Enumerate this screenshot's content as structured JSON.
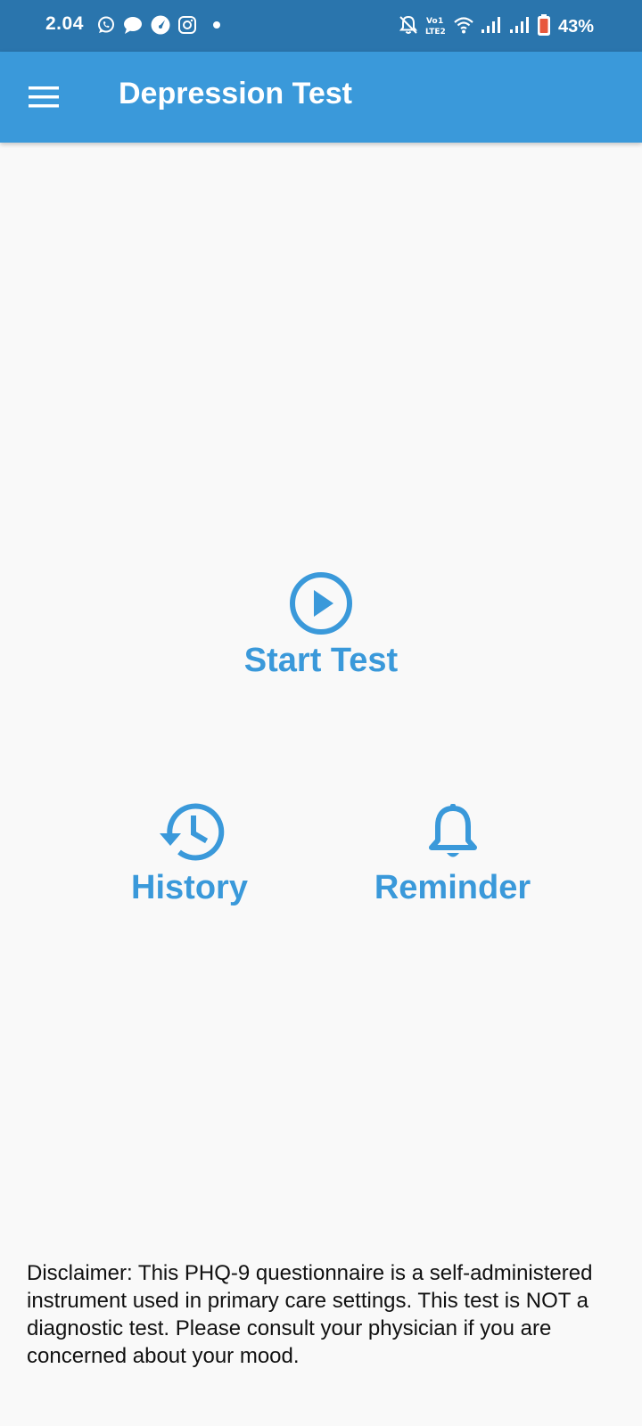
{
  "status_bar": {
    "time": "2.04",
    "battery_percent": "43%",
    "left_icons": [
      "whatsapp-icon",
      "chat-bubble-icon",
      "speedometer-icon",
      "instagram-icon",
      "dot-icon"
    ],
    "right_icons": [
      "mute-bell-icon",
      "volte-lte2-icon",
      "wifi-icon",
      "signal-icon",
      "signal-icon",
      "battery-icon"
    ]
  },
  "app_bar": {
    "title": "Depression Test",
    "menu_icon": "hamburger-menu-icon"
  },
  "actions": {
    "start_test": {
      "label": "Start Test",
      "icon": "play-circle-icon"
    },
    "history": {
      "label": "History",
      "icon": "history-clock-icon"
    },
    "reminder": {
      "label": "Reminder",
      "icon": "bell-icon"
    }
  },
  "disclaimer": "Disclaimer: This PHQ-9 questionnaire is a self-administered instrument used in primary care settings. This test is NOT a diagnostic test. Please consult your physician if you are concerned about your mood.",
  "colors": {
    "status_bar": "#2a75ad",
    "app_bar": "#3a99da",
    "accent": "#3a99da",
    "background": "#f9f9f9",
    "battery_low": "#e8583c"
  }
}
